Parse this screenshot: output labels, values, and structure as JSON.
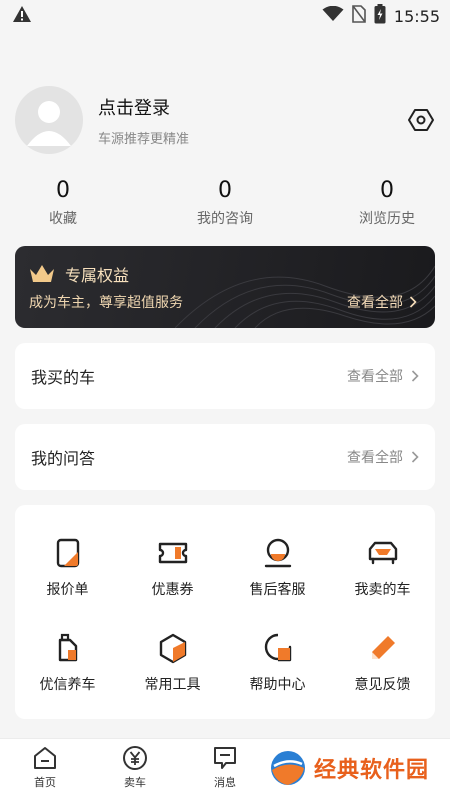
{
  "status_bar": {
    "time": "15:55"
  },
  "profile": {
    "title": "点击登录",
    "subtitle": "车源推荐更精准"
  },
  "stats": [
    {
      "value": "0",
      "label": "收藏"
    },
    {
      "value": "0",
      "label": "我的咨询"
    },
    {
      "value": "0",
      "label": "浏览历史"
    }
  ],
  "vip": {
    "title": "专属权益",
    "subtitle": "成为车主，尊享超值服务",
    "more": "查看全部"
  },
  "my_cars": {
    "title": "我买的车",
    "more": "查看全部"
  },
  "my_qa": {
    "title": "我的问答",
    "more": "查看全部"
  },
  "tools": [
    {
      "label": "报价单",
      "icon": "quote-sheet-icon"
    },
    {
      "label": "优惠券",
      "icon": "coupon-icon"
    },
    {
      "label": "售后客服",
      "icon": "customer-service-icon"
    },
    {
      "label": "我卖的车",
      "icon": "car-icon"
    },
    {
      "label": "优信养车",
      "icon": "oil-can-icon"
    },
    {
      "label": "常用工具",
      "icon": "toolbox-icon"
    },
    {
      "label": "帮助中心",
      "icon": "help-chat-icon"
    },
    {
      "label": "意见反馈",
      "icon": "pencil-icon"
    }
  ],
  "tabbar": [
    {
      "label": "首页",
      "icon": "home-icon"
    },
    {
      "label": "卖车",
      "icon": "yen-icon"
    },
    {
      "label": "消息",
      "icon": "message-icon"
    }
  ],
  "watermark": "经典软件园",
  "colors": {
    "accent": "#f07a2a",
    "vip_bg": "#1e1e21",
    "vip_text": "#f5dcb9"
  }
}
